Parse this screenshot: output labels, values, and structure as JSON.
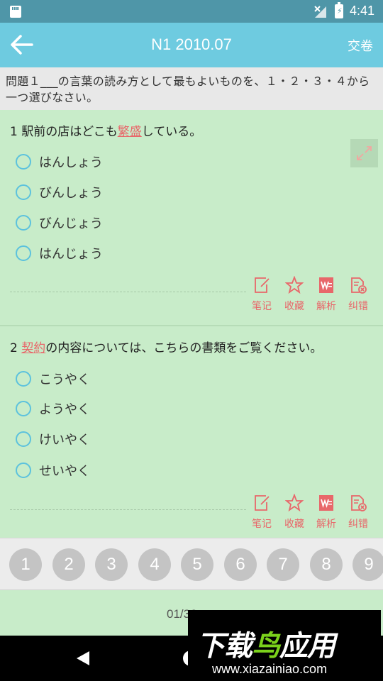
{
  "status_bar": {
    "time": "4:41",
    "icons": [
      "sd-card-icon",
      "signal-icon",
      "battery-charging-icon"
    ]
  },
  "header": {
    "title": "N1 2010.07",
    "submit_label": "交卷",
    "back_icon": "arrow-left-icon"
  },
  "instruction": {
    "text": "問題１___の言葉の読み方として最もよいものを、１・２・３・４から一つ選びなさい。"
  },
  "questions": [
    {
      "number": "1",
      "text_before": "駅前の店はどこも",
      "keyword": "繁盛",
      "text_after": "している。",
      "options": [
        "はんしょう",
        "びんしょう",
        "びんじょう",
        "はんじょう"
      ]
    },
    {
      "number": "2",
      "text_before": "",
      "keyword": "契約",
      "text_after": "の内容については、こちらの書類をご覧ください。",
      "options": [
        "こうやく",
        "ようやく",
        "けいやく",
        "せいやく"
      ]
    }
  ],
  "toolbar": {
    "note": "笔记",
    "favorite": "收藏",
    "analysis": "解析",
    "correct": "纠错"
  },
  "pager": {
    "numbers": [
      "1",
      "2",
      "3",
      "4",
      "5",
      "6",
      "7",
      "8",
      "9"
    ]
  },
  "footer": {
    "count": "01/36"
  },
  "watermark": {
    "brand_main": "下载",
    "brand_accent": "鸟",
    "brand_tail": "应用",
    "url": "www.xiazainiao.com"
  },
  "colors": {
    "status_bar": "#4f96a8",
    "app_bar": "#6ecbe0",
    "background": "#c8ecc9",
    "accent_red": "#e8676a",
    "radio": "#5cc2dd"
  }
}
